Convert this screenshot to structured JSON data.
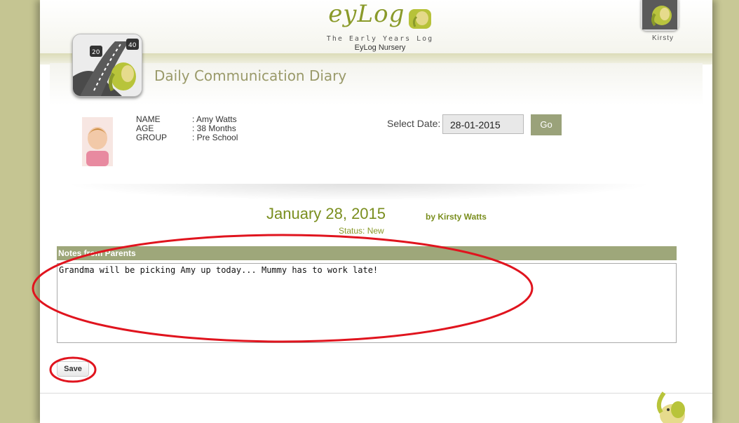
{
  "header": {
    "logo_text": "eyLog",
    "tagline": "The Early Years Log",
    "nursery_name": "EyLog Nursery",
    "user_name": "Kirsty"
  },
  "app": {
    "title": "Daily Communication Diary"
  },
  "child": {
    "labels": [
      "NAME",
      "AGE",
      "GROUP"
    ],
    "values": [
      ": Amy Watts",
      ": 38 Months",
      ": Pre School"
    ]
  },
  "date_picker": {
    "label": "Select Date:",
    "value": "28-01-2015",
    "go_label": "Go"
  },
  "entry": {
    "date": "January 28, 2015",
    "by": "by Kirsty Watts",
    "status": "Status: New"
  },
  "notes": {
    "header": "Notes from Parents",
    "text": "Grandma will be picking Amy up today... Mummy has to work late!"
  },
  "actions": {
    "save_label": "Save"
  },
  "colors": {
    "brand_green": "#7a8e1e",
    "header_olive": "#9ea77a",
    "annotation_red": "#e0141e"
  }
}
